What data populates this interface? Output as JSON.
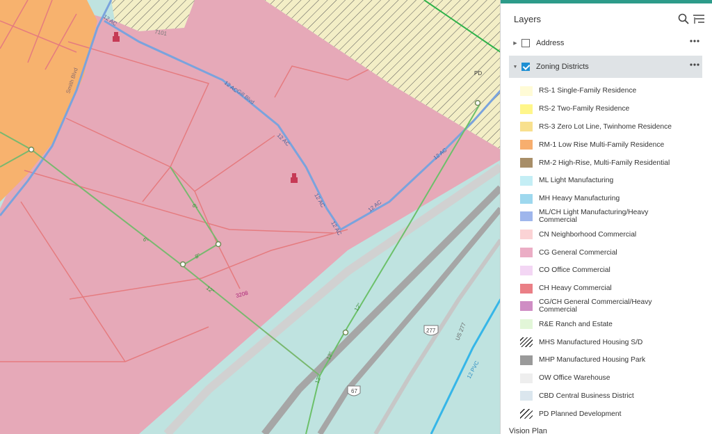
{
  "map": {
    "street_labels": {
      "smith_blvd": "Smith Blvd",
      "gill_blvd": "Gill Blvd",
      "us_277": "US 277"
    },
    "pipe_labels": [
      "12 AC",
      "12 AC",
      "12 AC",
      "12 AC",
      "12 AC",
      "12 AC",
      "12 AC",
      "12 PVC"
    ],
    "parcel_label": "PD",
    "lot_labels": [
      "7101",
      "3208"
    ],
    "shields": [
      "277",
      "67"
    ],
    "green_line_labels": [
      "6\"",
      "8\"",
      "6\"",
      "12\"",
      "12\"",
      "12\"",
      "12\""
    ]
  },
  "panel": {
    "title": "Layers",
    "layers": [
      {
        "label": "Address",
        "checked": false
      },
      {
        "label": "Zoning Districts",
        "checked": true
      }
    ],
    "legend": [
      {
        "label": "RS-1 Single-Family Residence",
        "color": "#fffbd6",
        "pattern": "solid"
      },
      {
        "label": "RS-2 Two-Family Residence",
        "color": "#fff68a",
        "pattern": "solid"
      },
      {
        "label": "RS-3 Zero Lot Line, Twinhome Residence",
        "color": "#f8e08e",
        "pattern": "solid"
      },
      {
        "label": "RM-1 Low Rise Multi-Family Residence",
        "color": "#f7ae6e",
        "pattern": "solid"
      },
      {
        "label": "RM-2 High-Rise, Multi-Family Residential",
        "color": "#a88e68",
        "pattern": "solid"
      },
      {
        "label": "ML Light Manufacturing",
        "color": "#c4eef5",
        "pattern": "solid"
      },
      {
        "label": "MH Heavy Manufacturing",
        "color": "#9ed8ee",
        "pattern": "solid"
      },
      {
        "label": "ML/CH Light Manufacturing/Heavy Commercial",
        "color": "#9fb6ec",
        "pattern": "solid"
      },
      {
        "label": "CN Neighborhood Commercial",
        "color": "#fbd3d5",
        "pattern": "solid"
      },
      {
        "label": "CG General Commercial",
        "color": "#ebadc5",
        "pattern": "solid"
      },
      {
        "label": "CO Office Commercial",
        "color": "#f3d6f4",
        "pattern": "solid"
      },
      {
        "label": "CH Heavy Commercial",
        "color": "#ea7f86",
        "pattern": "solid"
      },
      {
        "label": "CG/CH General Commercial/Heavy Commercial",
        "color": "#cf8dc4",
        "pattern": "solid"
      },
      {
        "label": "R&E Ranch and Estate",
        "color": "#e2f6d8",
        "pattern": "solid"
      },
      {
        "label": "MHS Manufactured Housing S/D",
        "color": "#ffffff",
        "pattern": "hatch-dense"
      },
      {
        "label": "MHP Manufactured Housing Park",
        "color": "#9a9a9a",
        "pattern": "solid"
      },
      {
        "label": "OW Office Warehouse",
        "color": "#eeeeee",
        "pattern": "solid"
      },
      {
        "label": "CBD Central Business District",
        "color": "#dbe6ee",
        "pattern": "solid"
      },
      {
        "label": "PD Planned Development",
        "color": "#ffffff",
        "pattern": "hatch"
      }
    ],
    "next_layer": "Vision Plan"
  }
}
